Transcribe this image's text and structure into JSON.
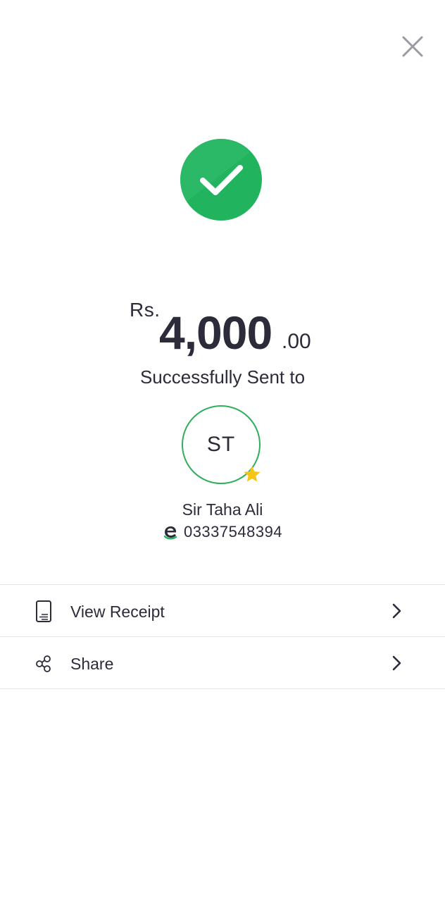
{
  "header": {
    "close_icon": "close-icon"
  },
  "status": {
    "icon": "check-circle-icon",
    "color": "#22b35e"
  },
  "amount": {
    "currency": "Rs.",
    "whole": "4,000",
    "fraction": ".00"
  },
  "message": "Successfully Sent to",
  "recipient": {
    "initials": "ST",
    "favorite_icon": "star-icon",
    "name": "Sir Taha Ali",
    "wallet_icon": "easypaisa-icon",
    "phone": "03337548394"
  },
  "actions": [
    {
      "label": "View Receipt",
      "icon": "receipt-icon"
    },
    {
      "label": "Share",
      "icon": "share-icon"
    }
  ],
  "colors": {
    "accent": "#2fae5b",
    "star": "#f5c518",
    "text": "#2b2b3a",
    "divider": "#e6e6ea"
  }
}
